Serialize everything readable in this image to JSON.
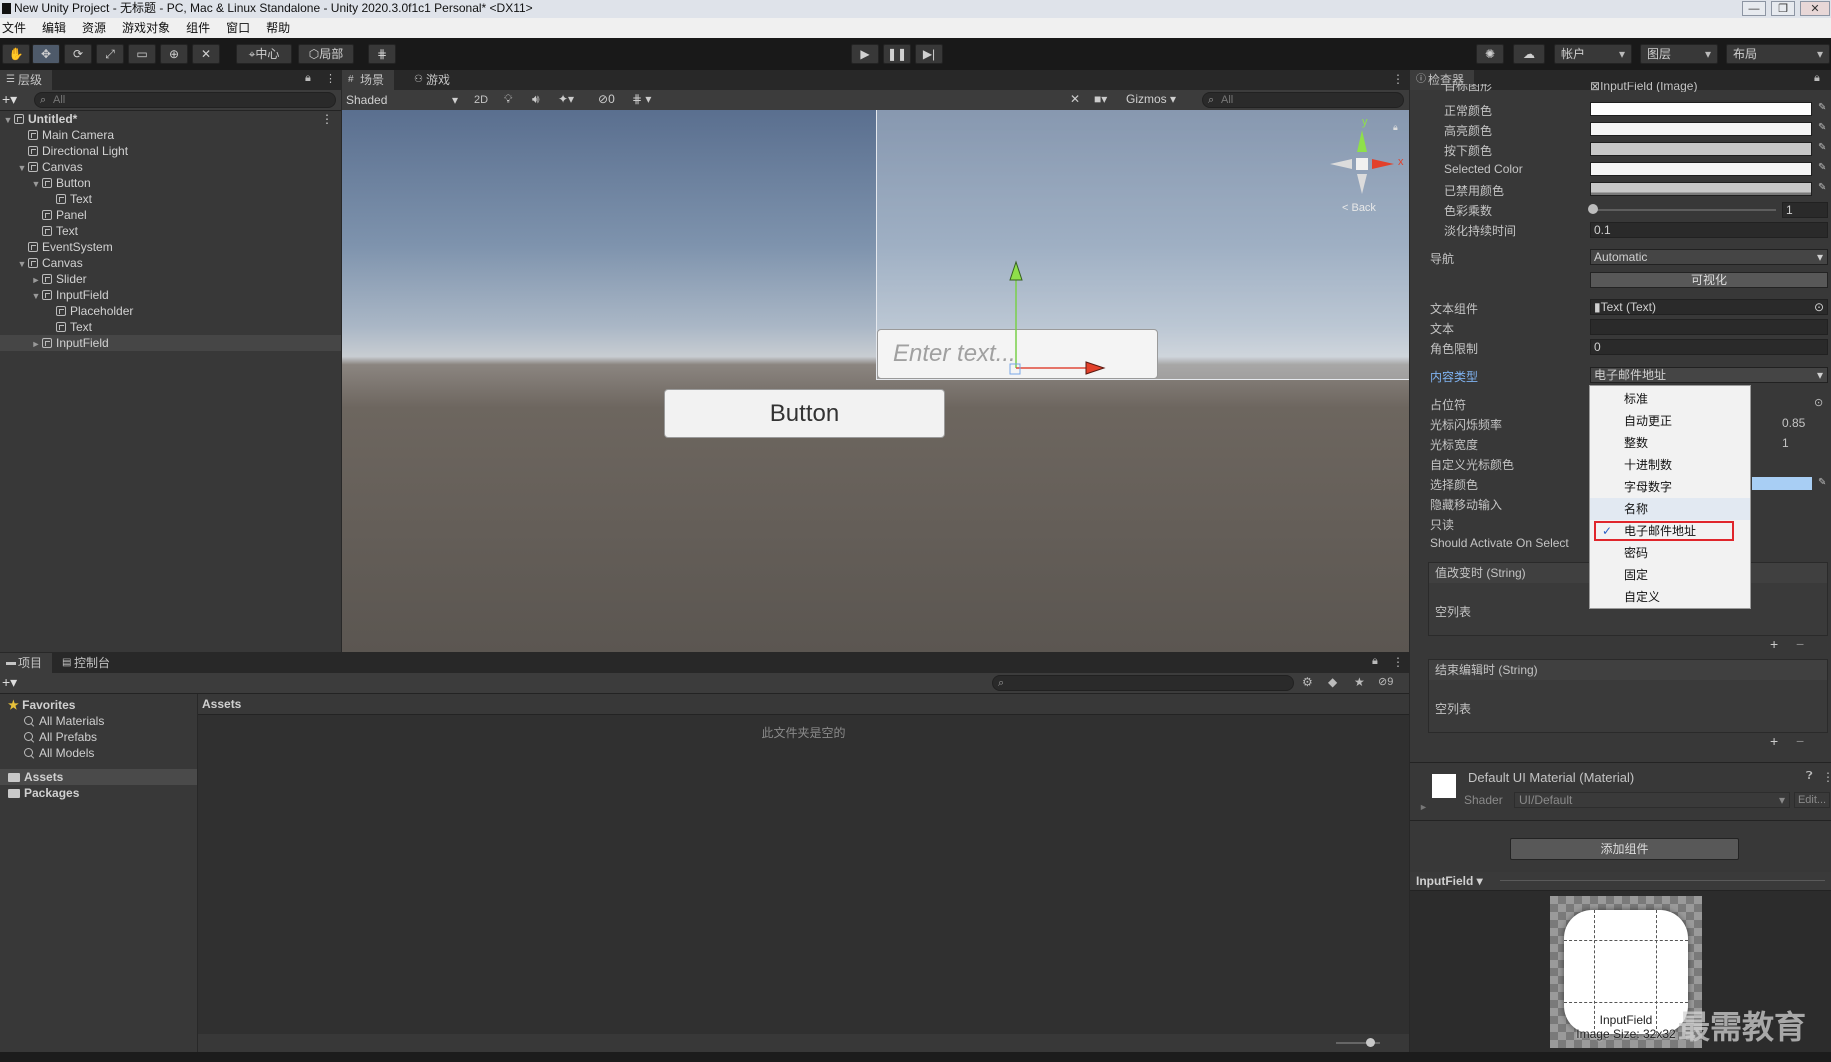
{
  "window": {
    "title": "New Unity Project - 无标题 - PC, Mac & Linux Standalone - Unity 2020.3.0f1c1 Personal* <DX11>",
    "controls": [
      "—",
      "❐",
      "✕"
    ]
  },
  "menubar": [
    "文件",
    "编辑",
    "资源",
    "游戏对象",
    "组件",
    "窗口",
    "帮助"
  ],
  "toolbar": {
    "pivot": "中心",
    "space": "局部",
    "account": "帐户",
    "layers": "图层",
    "layout": "布局"
  },
  "hierarchy": {
    "tab": "层级",
    "search_placeholder": "All",
    "items": [
      {
        "label": "Untitled*",
        "depth": 0,
        "fold": "▼",
        "scene": true
      },
      {
        "label": "Main Camera",
        "depth": 1,
        "fold": ""
      },
      {
        "label": "Directional Light",
        "depth": 1,
        "fold": ""
      },
      {
        "label": "Canvas",
        "depth": 1,
        "fold": "▼"
      },
      {
        "label": "Button",
        "depth": 2,
        "fold": "▼"
      },
      {
        "label": "Text",
        "depth": 3,
        "fold": ""
      },
      {
        "label": "Panel",
        "depth": 2,
        "fold": ""
      },
      {
        "label": "Text",
        "depth": 2,
        "fold": ""
      },
      {
        "label": "EventSystem",
        "depth": 1,
        "fold": ""
      },
      {
        "label": "Canvas",
        "depth": 1,
        "fold": "▼"
      },
      {
        "label": "Slider",
        "depth": 2,
        "fold": "►"
      },
      {
        "label": "InputField",
        "depth": 2,
        "fold": "▼"
      },
      {
        "label": "Placeholder",
        "depth": 3,
        "fold": ""
      },
      {
        "label": "Text",
        "depth": 3,
        "fold": ""
      },
      {
        "label": "InputField",
        "depth": 2,
        "fold": "►",
        "selected": true
      }
    ]
  },
  "scene": {
    "tabs": [
      "场景",
      "游戏"
    ],
    "shading": "Shaded",
    "mode_2d": "2D",
    "hidden_count": "0",
    "gizmos": "Gizmos",
    "search_placeholder": "All",
    "input_placeholder": "Enter text...",
    "button_label": "Button",
    "gizmo_back": "< Back",
    "axis_y": "y",
    "axis_x": "x"
  },
  "inspector": {
    "tab": "检查器",
    "target_graphic_label": "目标图形",
    "target_graphic_value": "InputField (Image)",
    "normal_color": "正常颜色",
    "highlight_color": "高亮颜色",
    "pressed_color": "按下颜色",
    "selected_color": "Selected Color",
    "disabled_color": "已禁用颜色",
    "color_multiplier": "色彩乘数",
    "color_multiplier_value": "1",
    "fade_duration": "淡化持续时间",
    "fade_duration_value": "0.1",
    "navigation": "导航",
    "navigation_value": "Automatic",
    "visualize": "可视化",
    "text_component": "文本组件",
    "text_component_value": "Text (Text)",
    "text": "文本",
    "character_limit": "角色限制",
    "character_limit_value": "0",
    "content_type": "内容类型",
    "content_type_value": "电子邮件地址",
    "placeholder": "占位符",
    "caret_blink_rate": "光标闪烁频率",
    "caret_blink_rate_value": "0.85",
    "caret_width": "光标宽度",
    "caret_width_value": "1",
    "custom_caret_color": "自定义光标颜色",
    "selection_color": "选择颜色",
    "hide_mobile_input": "隐藏移动输入",
    "read_only": "只读",
    "should_activate": "Should Activate On Select",
    "on_value_changed": "值改变时 (String)",
    "empty_list_1": "空列表",
    "on_end_edit": "结束编辑时 (String)",
    "empty_list_2": "空列表",
    "plus": "+",
    "minus": "−",
    "material_name": "Default UI Material (Material)",
    "shader_label": "Shader",
    "shader_value": "UI/Default",
    "edit": "Edit...",
    "add_component": "添加组件",
    "preview_title": "InputField ▾",
    "preview_caption": "InputField",
    "preview_size": "Image Size: 32x32",
    "watermark": "最需教育"
  },
  "content_type_menu": {
    "items": [
      "标准",
      "自动更正",
      "整数",
      "十进制数",
      "字母数字",
      "名称",
      "电子邮件地址",
      "密码",
      "固定",
      "自定义"
    ],
    "checked_index": 6,
    "highlighted_index": 5,
    "check_mark": "✓",
    "highlight_box_color": "#e0262b"
  },
  "project": {
    "tabs": [
      "项目",
      "控制台"
    ],
    "favorites_label": "Favorites",
    "favorites": [
      "All Materials",
      "All Prefabs",
      "All Models"
    ],
    "folders": [
      "Assets",
      "Packages"
    ],
    "breadcrumb": "Assets",
    "empty_message": "此文件夹是空的",
    "hidden_count": "9"
  }
}
